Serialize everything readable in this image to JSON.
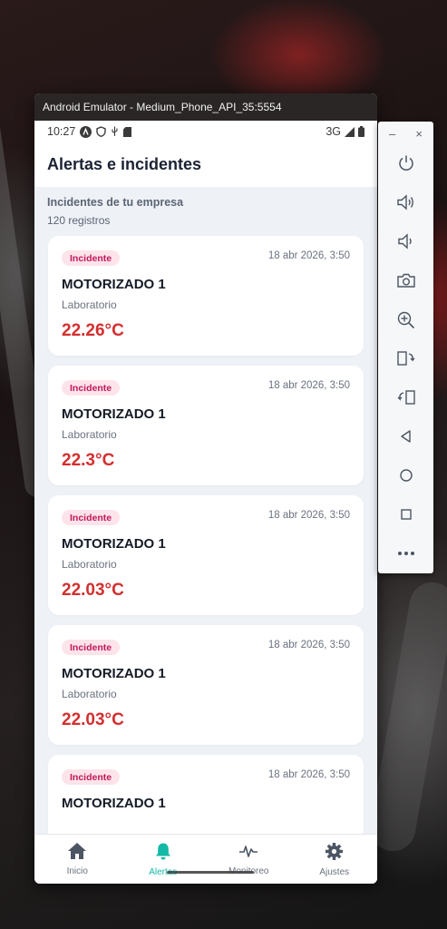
{
  "window": {
    "title": "Android Emulator - Medium_Phone_API_35:5554"
  },
  "statusbar": {
    "time": "10:27",
    "network": "3G"
  },
  "appbar": {
    "title": "Alertas e incidentes"
  },
  "section": {
    "title": "Incidentes de tu empresa",
    "count": "120 registros"
  },
  "cards": [
    {
      "badge": "Incidente",
      "date": "18 abr 2026, 3:50",
      "name": "MOTORIZADO 1",
      "location": "Laboratorio",
      "temp": "22.26°C"
    },
    {
      "badge": "Incidente",
      "date": "18 abr 2026, 3:50",
      "name": "MOTORIZADO 1",
      "location": "Laboratorio",
      "temp": "22.3°C"
    },
    {
      "badge": "Incidente",
      "date": "18 abr 2026, 3:50",
      "name": "MOTORIZADO 1",
      "location": "Laboratorio",
      "temp": "22.03°C"
    },
    {
      "badge": "Incidente",
      "date": "18 abr 2026, 3:50",
      "name": "MOTORIZADO 1",
      "location": "Laboratorio",
      "temp": "22.03°C"
    },
    {
      "badge": "Incidente",
      "date": "18 abr 2026, 3:50",
      "name": "MOTORIZADO 1"
    }
  ],
  "nav": {
    "items": [
      {
        "label": "Inicio",
        "icon": "home-icon"
      },
      {
        "label": "Alertas",
        "icon": "bell-icon"
      },
      {
        "label": "Monitoreo",
        "icon": "activity-icon"
      },
      {
        "label": "Ajustes",
        "icon": "gear-icon"
      }
    ],
    "active": "Alertas"
  },
  "colors": {
    "accent": "#14b8a6",
    "temp": "#d32f2f",
    "badge_bg": "#fde4ea",
    "badge_text": "#c2185b"
  }
}
